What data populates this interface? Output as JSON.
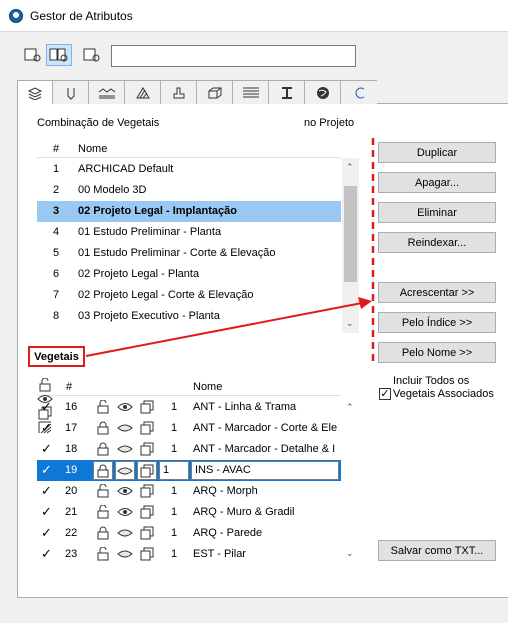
{
  "window": {
    "title": "Gestor de Atributos"
  },
  "icons": {
    "app": "archicad-app-icon",
    "toolbar": [
      "single-view-icon",
      "compare-view-icon",
      "file-search-icon"
    ],
    "tabs": [
      "layers-icon",
      "pen-icon",
      "line-types-icon",
      "fill-icon",
      "building-material-icon",
      "surface-icon",
      "composite-icon",
      "profile-icon",
      "globe-icon"
    ]
  },
  "search": {
    "value": ""
  },
  "combo": {
    "label": "Combinação de Vegetais",
    "in_project": "no Projeto",
    "header_num": "#",
    "header_name": "Nome",
    "rows": [
      {
        "num": "1",
        "name": "ARCHICAD Default"
      },
      {
        "num": "2",
        "name": "00 Modelo 3D"
      },
      {
        "num": "3",
        "name": "02 Projeto Legal - Implantação",
        "selected": true
      },
      {
        "num": "4",
        "name": "01 Estudo Preliminar - Planta"
      },
      {
        "num": "5",
        "name": "01 Estudo Preliminar - Corte & Elevação"
      },
      {
        "num": "6",
        "name": "02 Projeto Legal - Planta"
      },
      {
        "num": "7",
        "name": "02 Projeto Legal - Corte & Elevação"
      },
      {
        "num": "8",
        "name": "03 Projeto Executivo - Planta"
      }
    ]
  },
  "buttons": {
    "duplicar": "Duplicar",
    "apagar": "Apagar...",
    "eliminar": "Eliminar",
    "reindexar": "Reindexar...",
    "acrescentar": "Acrescentar >>",
    "pelo_indice": "Pelo Índice >>",
    "pelo_nome": "Pelo Nome >>",
    "salvar": "Salvar como TXT..."
  },
  "vegetais": {
    "label": "Vegetais",
    "header_num": "#",
    "header_name": "Nome",
    "include_label_1": "Incluir Todos os",
    "include_label_2": "Vegetais Associados",
    "include_checked": true,
    "rows": [
      {
        "num": "16",
        "count": "1",
        "name": "ANT - Linha & Trama",
        "lock": "unlocked",
        "eye": "open"
      },
      {
        "num": "17",
        "count": "1",
        "name": "ANT - Marcador - Corte & Ele",
        "lock": "locked",
        "eye": "closed"
      },
      {
        "num": "18",
        "count": "1",
        "name": "ANT - Marcador - Detalhe & I",
        "lock": "locked",
        "eye": "closed"
      },
      {
        "num": "19",
        "count": "1",
        "name": "INS - AVAC",
        "lock": "locked",
        "eye": "closed",
        "selected": true
      },
      {
        "num": "20",
        "count": "1",
        "name": "ARQ - Morph",
        "lock": "unlocked",
        "eye": "open"
      },
      {
        "num": "21",
        "count": "1",
        "name": "ARQ - Muro & Gradil",
        "lock": "unlocked",
        "eye": "open"
      },
      {
        "num": "22",
        "count": "1",
        "name": "ARQ - Parede",
        "lock": "locked",
        "eye": "closed"
      },
      {
        "num": "23",
        "count": "1",
        "name": "EST - Pilar",
        "lock": "unlocked",
        "eye": "closed"
      }
    ]
  },
  "colors": {
    "annotation_red": "#e01b1b",
    "selection_light": "#99c9f3",
    "selection_dark": "#0f78d7"
  }
}
